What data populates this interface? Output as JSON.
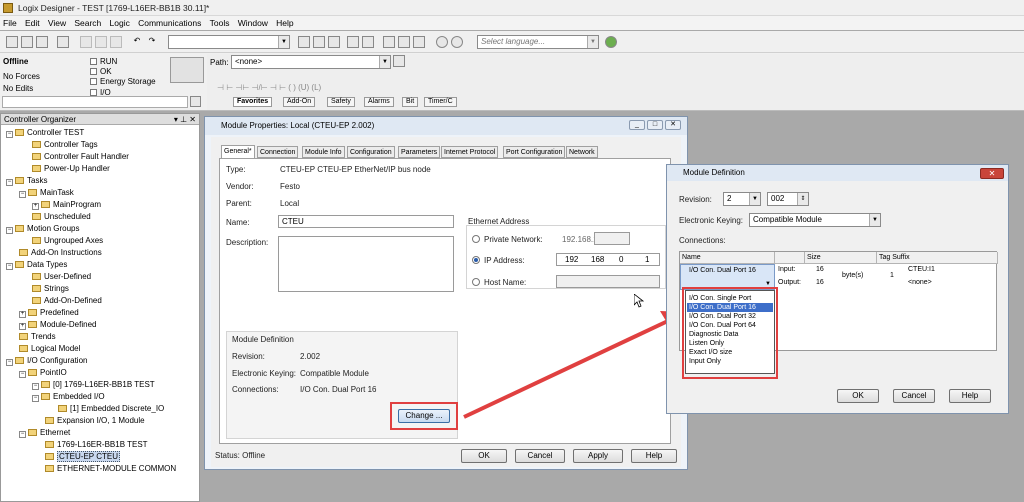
{
  "app_title": "Logix Designer - TEST [1769-L16ER-BB1B 30.11]*",
  "menu": [
    "File",
    "Edit",
    "View",
    "Search",
    "Logic",
    "Communications",
    "Tools",
    "Window",
    "Help"
  ],
  "toolbar": {
    "language_placeholder": "Select language..."
  },
  "status": {
    "mode": "Offline",
    "forces": "No Forces",
    "edits": "No Edits",
    "run": "RUN",
    "ok": "OK",
    "energy": "Energy Storage",
    "io": "I/O"
  },
  "path": {
    "label": "Path:",
    "value": "<none>"
  },
  "ladder_tabs": [
    "Favorites",
    "Add-On",
    "Safety",
    "Alarms",
    "Bit",
    "Timer/C"
  ],
  "organizer": {
    "title": "Controller Organizer",
    "items": [
      "Controller TEST",
      "Controller Tags",
      "Controller Fault Handler",
      "Power-Up Handler",
      "Tasks",
      "MainTask",
      "MainProgram",
      "Unscheduled",
      "Motion Groups",
      "Ungrouped Axes",
      "Add-On Instructions",
      "Data Types",
      "User-Defined",
      "Strings",
      "Add-On-Defined",
      "Predefined",
      "Module-Defined",
      "Trends",
      "Logical Model",
      "I/O Configuration",
      "PointIO",
      "[0] 1769-L16ER-BB1B TEST",
      "Embedded I/O",
      "[1] Embedded Discrete_IO",
      "Expansion I/O, 1 Module",
      "Ethernet",
      "1769-L16ER-BB1B TEST",
      "CTEU-EP CTEU",
      "ETHERNET-MODULE COMMON"
    ]
  },
  "module_properties": {
    "title": "Module Properties: Local (CTEU-EP 2.002)",
    "tabs": [
      "General*",
      "Connection",
      "Module Info",
      "Configuration",
      "Parameters",
      "Internet Protocol",
      "Port Configuration",
      "Network"
    ],
    "type_label": "Type:",
    "type_value": "CTEU-EP CTEU-EP EtherNet/IP bus node",
    "vendor_label": "Vendor:",
    "vendor_value": "Festo",
    "parent_label": "Parent:",
    "parent_value": "Local",
    "name_label": "Name:",
    "name_value": "CTEU",
    "description_label": "Description:",
    "ethernet_label": "Ethernet Address",
    "private_label": "Private Network:",
    "private_value": "192.168.1.",
    "ip_label": "IP Address:",
    "ip": [
      "192",
      "168",
      "0",
      "1"
    ],
    "host_label": "Host Name:",
    "def_group": "Module Definition",
    "revision_label": "Revision:",
    "revision_value": "2.002",
    "keying_label": "Electronic Keying:",
    "keying_value": "Compatible Module",
    "connections_label": "Connections:",
    "connections_value": "I/O Con. Dual Port 16",
    "change_label": "Change ...",
    "status_text": "Status: Offline",
    "ok": "OK",
    "cancel": "Cancel",
    "apply": "Apply",
    "help": "Help"
  },
  "module_definition": {
    "title": "Module Definition",
    "revision_label": "Revision:",
    "revision_major": "2",
    "revision_minor": "002",
    "keying_label": "Electronic Keying:",
    "keying_value": "Compatible Module",
    "connections_label": "Connections:",
    "grid_headers": [
      "Name",
      "Size",
      "Tag Suffix"
    ],
    "row": {
      "name": "I/O Con. Dual Port 16",
      "input_label": "Input:",
      "input_size": "16",
      "output_label": "Output:",
      "output_size": "16",
      "unit": "byte(s)",
      "count": "1",
      "suffix_in": "CTEU:I1",
      "suffix_out": "<none>"
    },
    "dropdown_options": [
      "I/O Con. Single Port",
      "I/O Con. Dual Port 16",
      "I/O Con. Dual Port 32",
      "I/O Con. Dual Port 64",
      "Diagnostic Data",
      "Listen Only",
      "Exact I/O size",
      "Input Only"
    ],
    "ok": "OK",
    "cancel": "Cancel",
    "help": "Help"
  },
  "colors": {
    "highlight": "#e04040",
    "selection": "#3d6ec9"
  }
}
